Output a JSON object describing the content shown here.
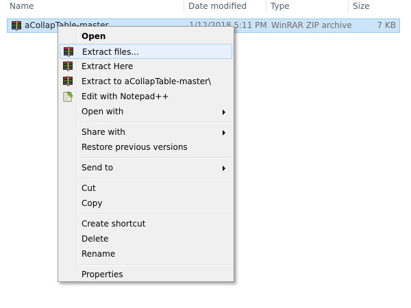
{
  "columns": {
    "name": "Name",
    "date_modified": "Date modified",
    "type": "Type",
    "size": "Size"
  },
  "file": {
    "name": "aCollapTable-master",
    "date_modified": "1/12/2018 5:11 PM",
    "type": "WinRAR ZIP archive",
    "size": "7 KB",
    "icon": "winrar-archive-icon"
  },
  "menu": {
    "open": "Open",
    "extract_files": "Extract files...",
    "extract_here": "Extract Here",
    "extract_to": "Extract to aCollapTable-master\\",
    "edit_notepad": "Edit with Notepad++",
    "open_with": "Open with",
    "share_with": "Share with",
    "restore_previous": "Restore previous versions",
    "send_to": "Send to",
    "cut": "Cut",
    "copy": "Copy",
    "create_shortcut": "Create shortcut",
    "delete": "Delete",
    "rename": "Rename",
    "properties": "Properties"
  },
  "colors": {
    "selection": "#cce4f7",
    "menu_background": "#f0f0f0",
    "menu_hover": "#e8f1fb"
  }
}
